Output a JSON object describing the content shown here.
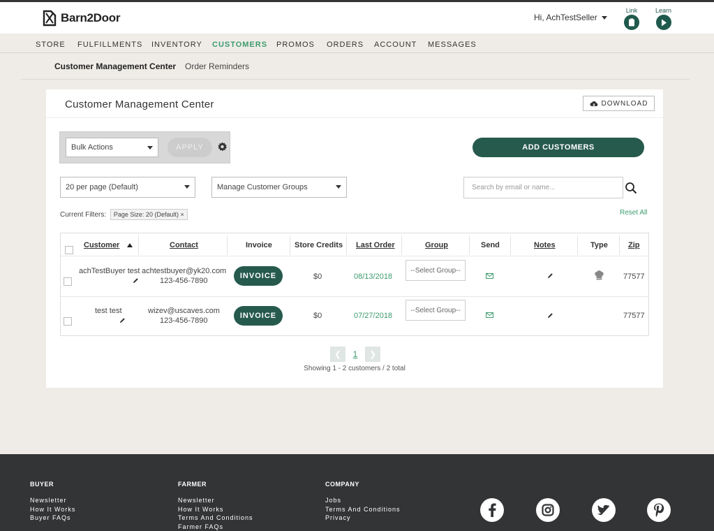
{
  "header": {
    "brand": "Barn2Door",
    "greeting": "Hi, AchTestSeller",
    "link_label": "Link",
    "learn_label": "Learn"
  },
  "nav": {
    "items": [
      "STORE",
      "FULFILLMENTS",
      "INVENTORY",
      "CUSTOMERS",
      "PROMOS",
      "ORDERS",
      "ACCOUNT",
      "MESSAGES"
    ],
    "active": "CUSTOMERS"
  },
  "subnav": {
    "current": "Customer Management Center",
    "other": "Order Reminders"
  },
  "panel": {
    "title": "Customer Management Center",
    "download_label": "DOWNLOAD",
    "bulk_actions_value": "Bulk Actions",
    "apply_label": "APPLY",
    "add_customers_label": "ADD CUSTOMERS",
    "per_page_value": "20 per page (Default)",
    "groups_value": "Manage Customer Groups",
    "search_placeholder": "Search by email or name...",
    "filters_label": "Current Filters:",
    "filter_chip": "Page Size: 20 (Default) ×",
    "reset_label": "Reset All"
  },
  "table": {
    "headers": {
      "customer": "Customer",
      "contact": "Contact",
      "invoice": "Invoice",
      "credits": "Store Credits",
      "last_order": "Last Order",
      "group": "Group",
      "send": "Send",
      "notes": "Notes",
      "type": "Type",
      "zip": "Zip"
    },
    "rows": [
      {
        "customer": "achTestBuyer test",
        "email": "achtestbuyer@yk20.com",
        "phone": "123-456-7890",
        "invoice": "INVOICE",
        "credits": "$0",
        "last_order": "08/13/2018",
        "group": "--Select Group--",
        "zip": "77577"
      },
      {
        "customer": "test test",
        "email": "wizev@uscaves.com",
        "phone": "123-456-7890",
        "invoice": "INVOICE",
        "credits": "$0",
        "last_order": "07/27/2018",
        "group": "--Select Group--",
        "zip": "77577"
      }
    ]
  },
  "pagination": {
    "page": "1",
    "showing": "Showing 1 - 2 customers / 2 total"
  },
  "footer": {
    "buyer": {
      "title": "BUYER",
      "links": [
        "Newsletter",
        "How It Works",
        "Buyer FAQs"
      ]
    },
    "farmer": {
      "title": "FARMER",
      "links": [
        "Newsletter",
        "How It Works",
        "Terms And Conditions",
        "Farmer FAQs"
      ]
    },
    "company": {
      "title": "COMPANY",
      "links": [
        "Jobs",
        "Terms And Conditions",
        "Privacy"
      ]
    }
  },
  "colors": {
    "accent_green": "#265a4d",
    "link_green": "#3c9b6e",
    "footer_bg": "#333436",
    "page_bg": "#efece7"
  }
}
